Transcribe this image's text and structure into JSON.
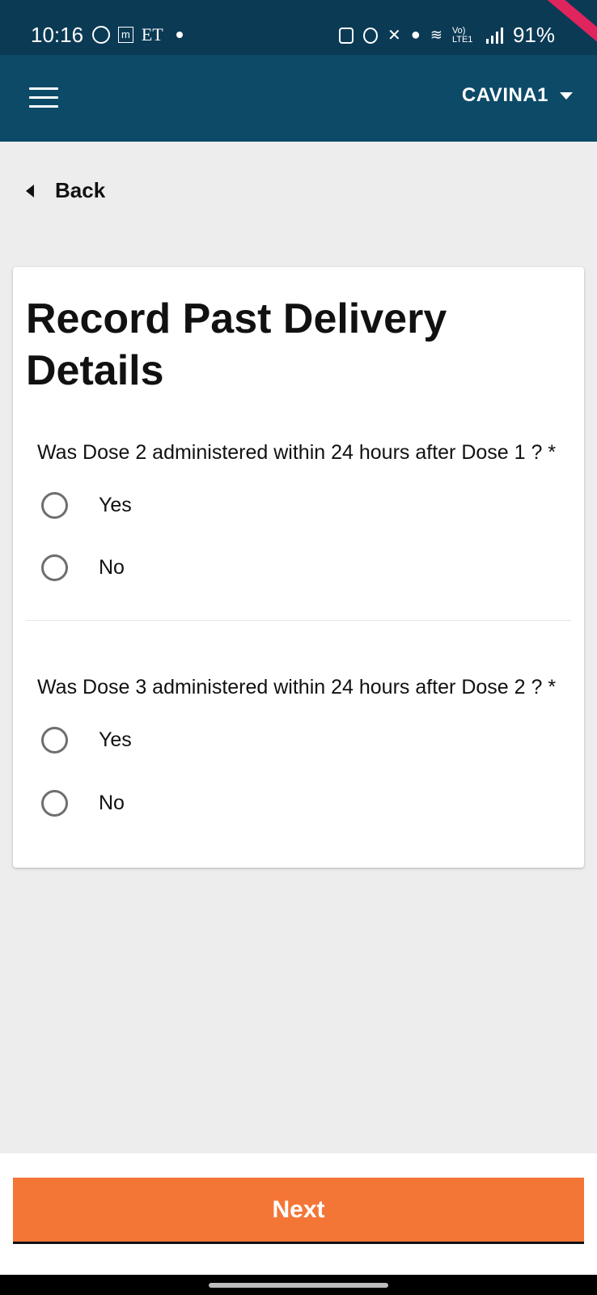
{
  "status_bar": {
    "time": "10:16",
    "carrier_text": "ET",
    "m_icon_text": "m",
    "network_text": "Vo) LTE1",
    "battery": "91%",
    "icons": [
      "whatsapp-icon",
      "notification-icon",
      "battery-saver-icon",
      "alarm-icon",
      "mute-icon",
      "location-icon",
      "wifi-icon",
      "signal-icon"
    ]
  },
  "app_bar": {
    "account_name": "CAVINA1"
  },
  "back_label": "Back",
  "page_title": "Record Past Delivery Details",
  "questions": [
    {
      "text": "Was Dose 2 administered within 24 hours after Dose 1 ? *",
      "options": [
        "Yes",
        "No"
      ]
    },
    {
      "text": "Was Dose 3 administered within 24 hours after Dose 2 ? *",
      "options": [
        "Yes",
        "No"
      ]
    }
  ],
  "next_label": "Next",
  "colors": {
    "status_bar": "#0b3a55",
    "app_bar": "#0c4a68",
    "primary_button": "#f47637",
    "background": "#ededed"
  }
}
